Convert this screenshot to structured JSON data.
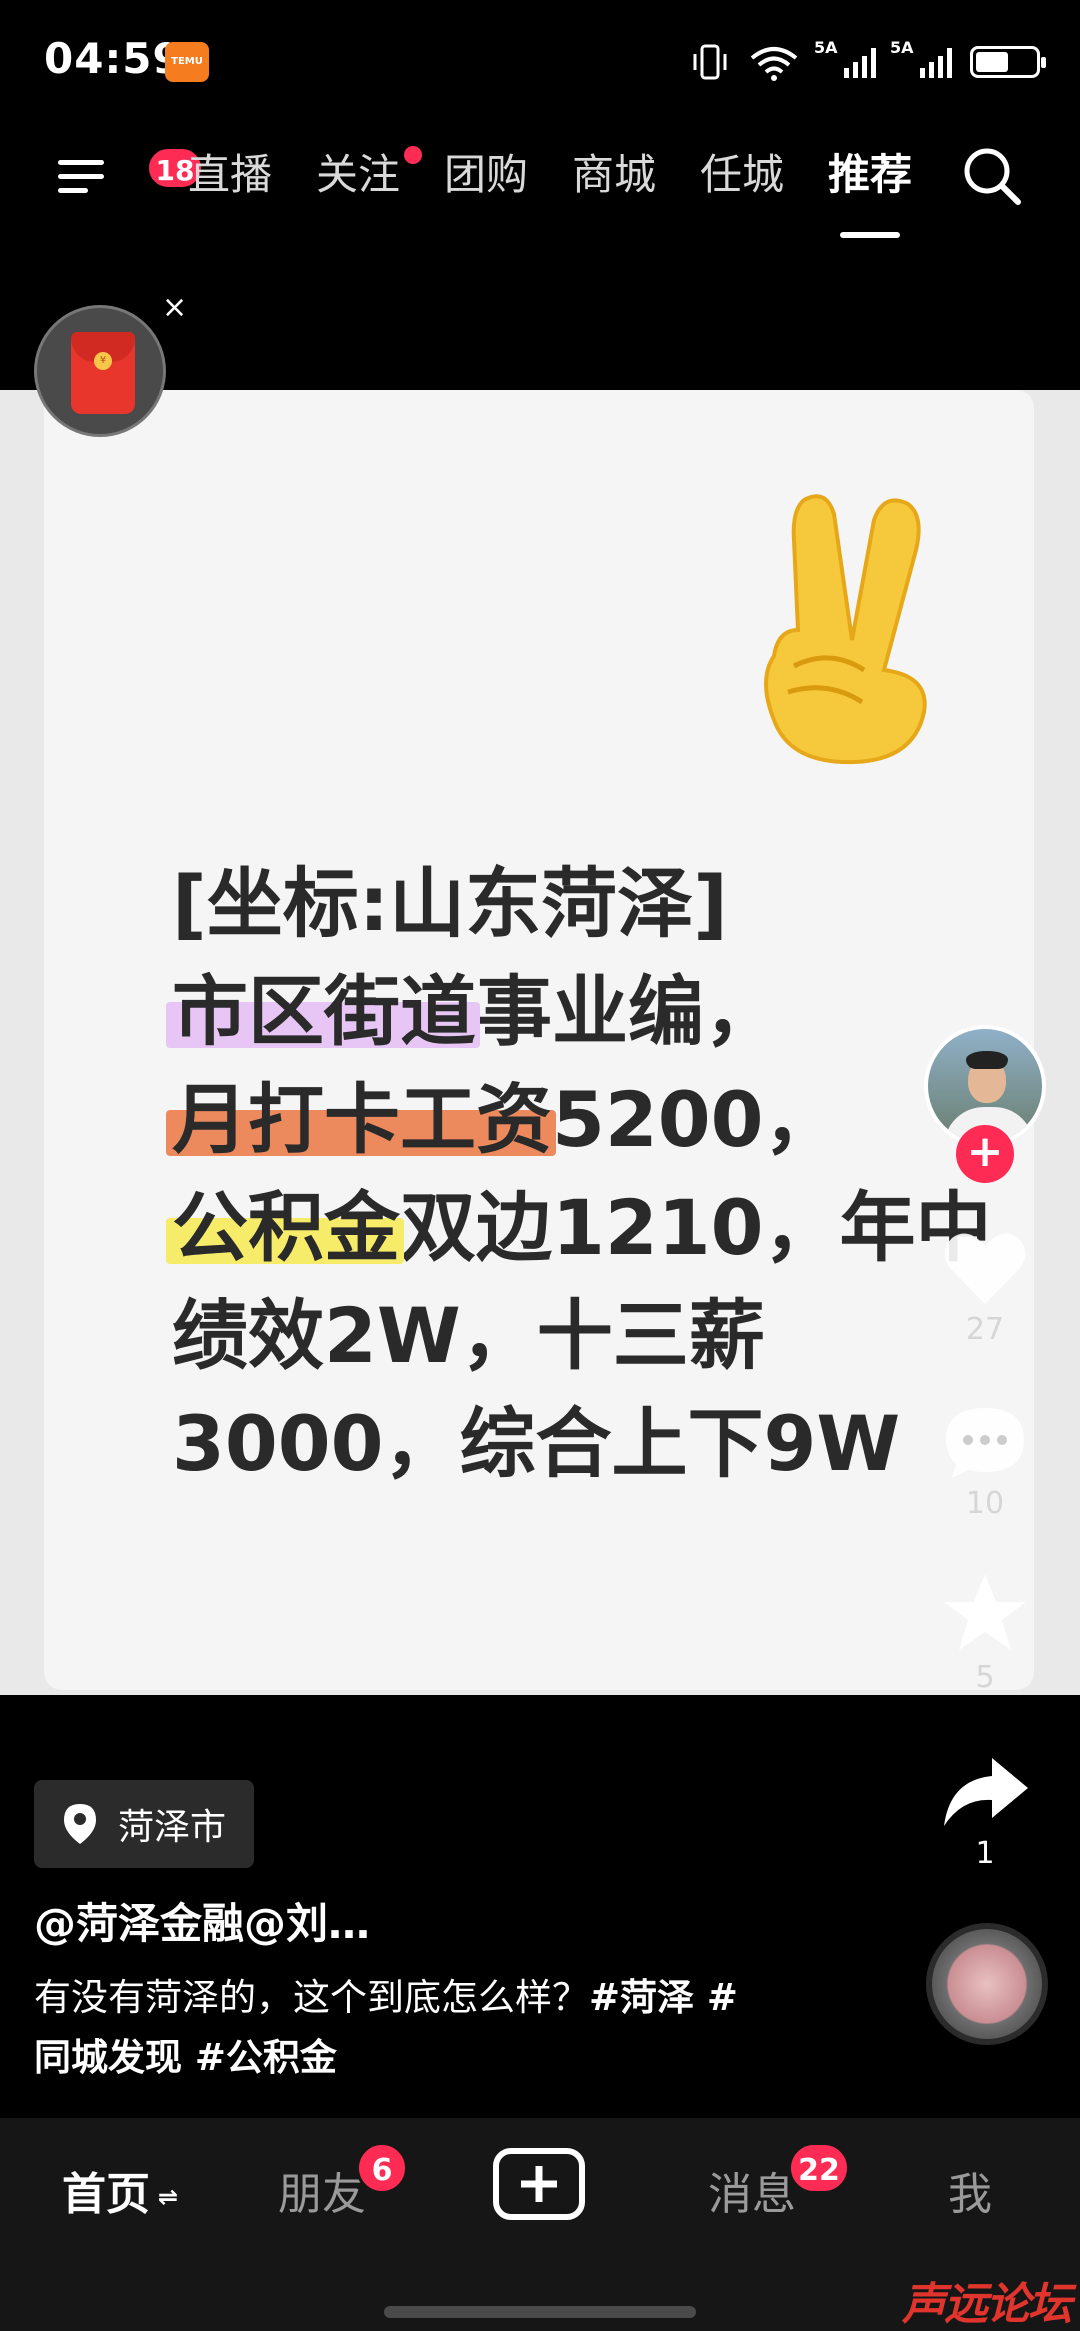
{
  "status_bar": {
    "time": "04:59",
    "app_icon_text": "TEMU",
    "net1": "5A",
    "net2": "5A",
    "battery_level": 0.55
  },
  "top_nav": {
    "menu_badge": "18",
    "tabs": [
      {
        "label": "直播",
        "active": false
      },
      {
        "label": "关注",
        "active": false,
        "dot": true
      },
      {
        "label": "团购",
        "active": false
      },
      {
        "label": "商城",
        "active": false
      },
      {
        "label": "任城",
        "active": false
      },
      {
        "label": "推荐",
        "active": true
      }
    ]
  },
  "red_packet": {
    "close": "×",
    "coin": "¥"
  },
  "video": {
    "emoji": "✌",
    "caption": {
      "l1": "[坐标:山东菏泽]",
      "l2_hl": "市区街道",
      "l2_rest": "事业编，",
      "l3_hl": "月打卡工资",
      "l3_rest": "5200，",
      "l4_hl": "公积金",
      "l4_rest": "双边1210，年中",
      "l5": "绩效2W，十三薪",
      "l6": "3000，综合上下9W"
    }
  },
  "right_rail": {
    "follow": "+",
    "likes": "27",
    "comments": "10",
    "favorites": "5",
    "shares": "1"
  },
  "info": {
    "location": "菏泽市",
    "author": "@菏泽金融@刘…",
    "desc_text": "有没有菏泽的，这个到底怎么样？",
    "tag1": "#菏泽 #",
    "tag2": "同城发现 #公积金"
  },
  "bottom_bar": {
    "home": "首页",
    "home_swap": "⇌",
    "friends": "朋友",
    "friends_badge": "6",
    "messages": "消息",
    "messages_badge": "22",
    "me": "我"
  },
  "watermark": "声远论坛",
  "colors": {
    "accent": "#fe2c55",
    "highlight_purple": "#e7c6f5",
    "highlight_orange": "#ec8a5e",
    "highlight_yellow": "#f7ec6a"
  }
}
